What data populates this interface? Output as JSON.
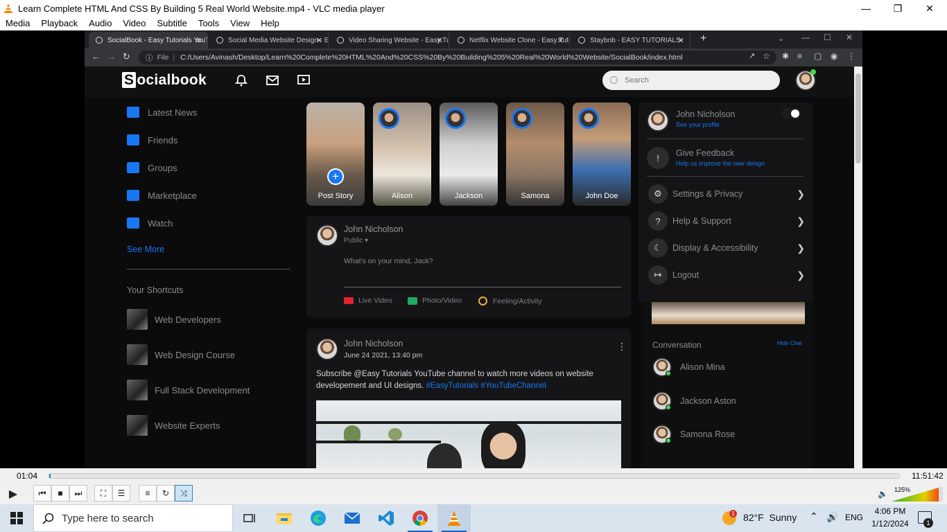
{
  "window": {
    "title": "Learn Complete HTML And CSS By Building 5 Real World Website.mp4 - VLC media player"
  },
  "menu": [
    "Media",
    "Playback",
    "Audio",
    "Video",
    "Subtitle",
    "Tools",
    "View",
    "Help"
  ],
  "browser": {
    "tabs": [
      {
        "label": "SocialBook - Easy Tutorials YouTube"
      },
      {
        "label": "Social Media Website Design - Easy"
      },
      {
        "label": "Video Sharing Website - Easy Tut"
      },
      {
        "label": "Netflix Website Clone - Easy Tuto"
      },
      {
        "label": "Staybnb - EASY TUTORIALS"
      }
    ],
    "address_prefix": "File",
    "url": "C:/Users/Avinash/Desktop/Learn%20Complete%20HTML%20And%20CSS%20By%20Building%205%20Real%20World%20Website/SocialBook/index.html"
  },
  "site": {
    "logo_letter": "S",
    "logo_rest": "ocialbook",
    "search_placeholder": "Search",
    "sidebar": [
      {
        "label": "Latest News"
      },
      {
        "label": "Friends"
      },
      {
        "label": "Groups"
      },
      {
        "label": "Marketplace"
      },
      {
        "label": "Watch"
      }
    ],
    "see_more": "See More",
    "shortcuts_title": "Your Shortcuts",
    "shortcuts": [
      {
        "label": "Web Developers"
      },
      {
        "label": "Web Design Course"
      },
      {
        "label": "Full Stack Development"
      },
      {
        "label": "Website Experts"
      }
    ],
    "stories": [
      {
        "label": "Post Story"
      },
      {
        "label": "Alison"
      },
      {
        "label": "Jackson"
      },
      {
        "label": "Samona"
      },
      {
        "label": "John Doe"
      }
    ],
    "composer": {
      "name": "John Nicholson",
      "privacy": "Public ▾",
      "placeholder": "What's on your mind, Jack?",
      "actions": [
        {
          "label": "Live Video"
        },
        {
          "label": "Photo/Video"
        },
        {
          "label": "Feeling/Activity"
        }
      ]
    },
    "post": {
      "name": "John Nicholson",
      "date": "June 24 2021, 13:40 pm",
      "text": "Subscribe @Easy Tutorials YouTube channel to watch more videos on website developement and UI designs.",
      "tags": "#EasyTutorials #YouTubeChannel"
    },
    "settings": {
      "profile_name": "John Nicholson",
      "profile_link": "See your profile",
      "feedback_title": "Give Feedback",
      "feedback_sub": "Help us improve the new deisgn",
      "items": [
        {
          "label": "Settings & Privacy"
        },
        {
          "label": "Help & Support"
        },
        {
          "label": "Display & Accessibility"
        },
        {
          "label": "Logout"
        }
      ]
    },
    "conversation": {
      "title": "Conversation",
      "hide": "Hide Chat",
      "people": [
        {
          "label": "Alison Mina"
        },
        {
          "label": "Jackson Aston"
        },
        {
          "label": "Samona Rose"
        }
      ]
    }
  },
  "player": {
    "elapsed": "01:04",
    "total": "11:51:42",
    "progress_fraction": 0.0015,
    "volume_label": "125%"
  },
  "taskbar": {
    "search_placeholder": "Type here to search",
    "weather": "82°F  Sunny",
    "weather_badge": "1",
    "lang": "ENG",
    "time": "4:06 PM",
    "date": "1/12/2024",
    "notif_count": "1"
  }
}
